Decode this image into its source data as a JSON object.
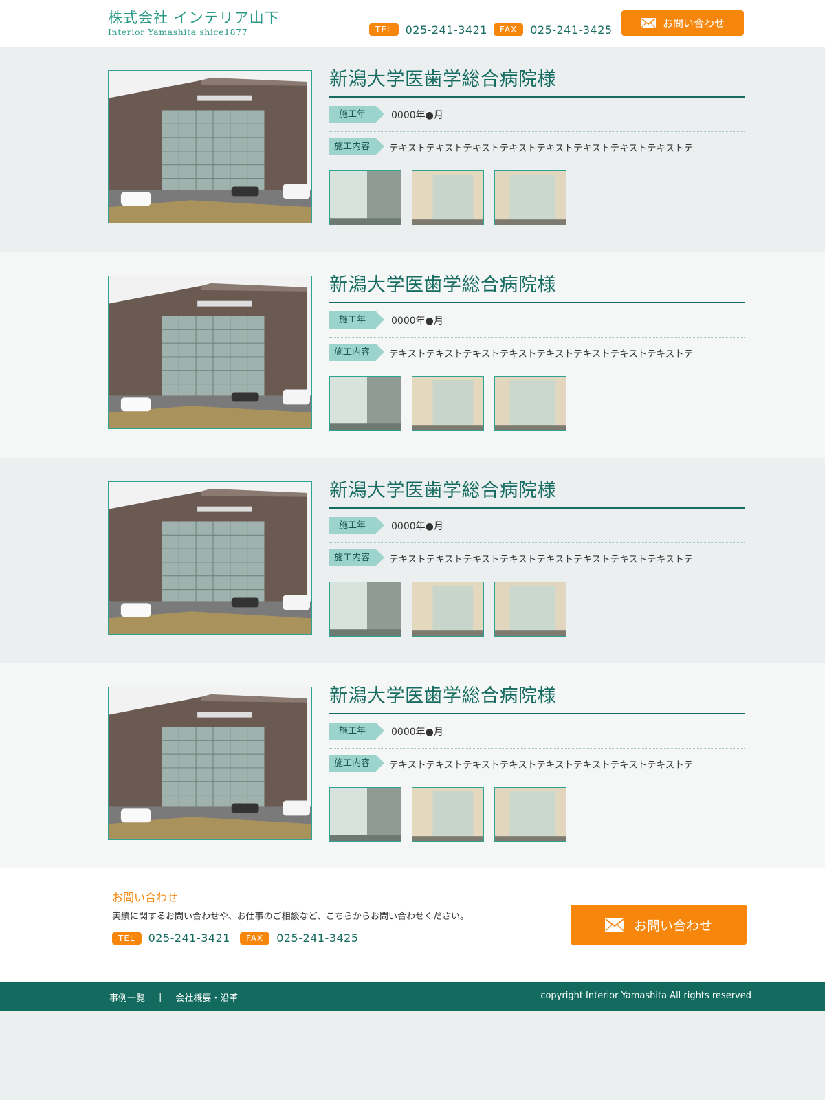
{
  "header": {
    "logo_jp": "株式会社 インテリア山下",
    "logo_en": "Interior Yamashita shice1877",
    "tel_badge": "TEL",
    "tel_number": "025-241-3421",
    "fax_badge": "FAX",
    "fax_number": "025-241-3425",
    "contact_button": "お問い合わせ"
  },
  "entries": [
    {
      "title": "新潟大学医歯学総合病院様",
      "year_label": "施工年",
      "year_value": "0000年●月",
      "content_label": "施工内容",
      "content_value": "テキストテキストテキストテキストテキストテキストテキストテキストテ"
    },
    {
      "title": "新潟大学医歯学総合病院様",
      "year_label": "施工年",
      "year_value": "0000年●月",
      "content_label": "施工内容",
      "content_value": "テキストテキストテキストテキストテキストテキストテキストテキストテ"
    },
    {
      "title": "新潟大学医歯学総合病院様",
      "year_label": "施工年",
      "year_value": "0000年●月",
      "content_label": "施工内容",
      "content_value": "テキストテキストテキストテキストテキストテキストテキストテキストテ"
    },
    {
      "title": "新潟大学医歯学総合病院様",
      "year_label": "施工年",
      "year_value": "0000年●月",
      "content_label": "施工内容",
      "content_value": "テキストテキストテキストテキストテキストテキストテキストテキストテ"
    }
  ],
  "contact": {
    "title": "お問い合わせ",
    "description": "実績に関するお問い合わせや、お仕事のご相談など、こちらからお問い合わせください。",
    "tel_badge": "TEL",
    "tel_number": "025-241-3421",
    "fax_badge": "FAX",
    "fax_number": "025-241-3425",
    "button": "お問い合わせ"
  },
  "footer": {
    "nav": [
      "事例一覧",
      "会社概要・沿革"
    ],
    "separator": "|",
    "copyright": "copyright Interior Yamashita All rights reserved"
  },
  "colors": {
    "accent_orange": "#f7860c",
    "brand_green": "#176c62",
    "label_teal": "#9dd3cd"
  }
}
